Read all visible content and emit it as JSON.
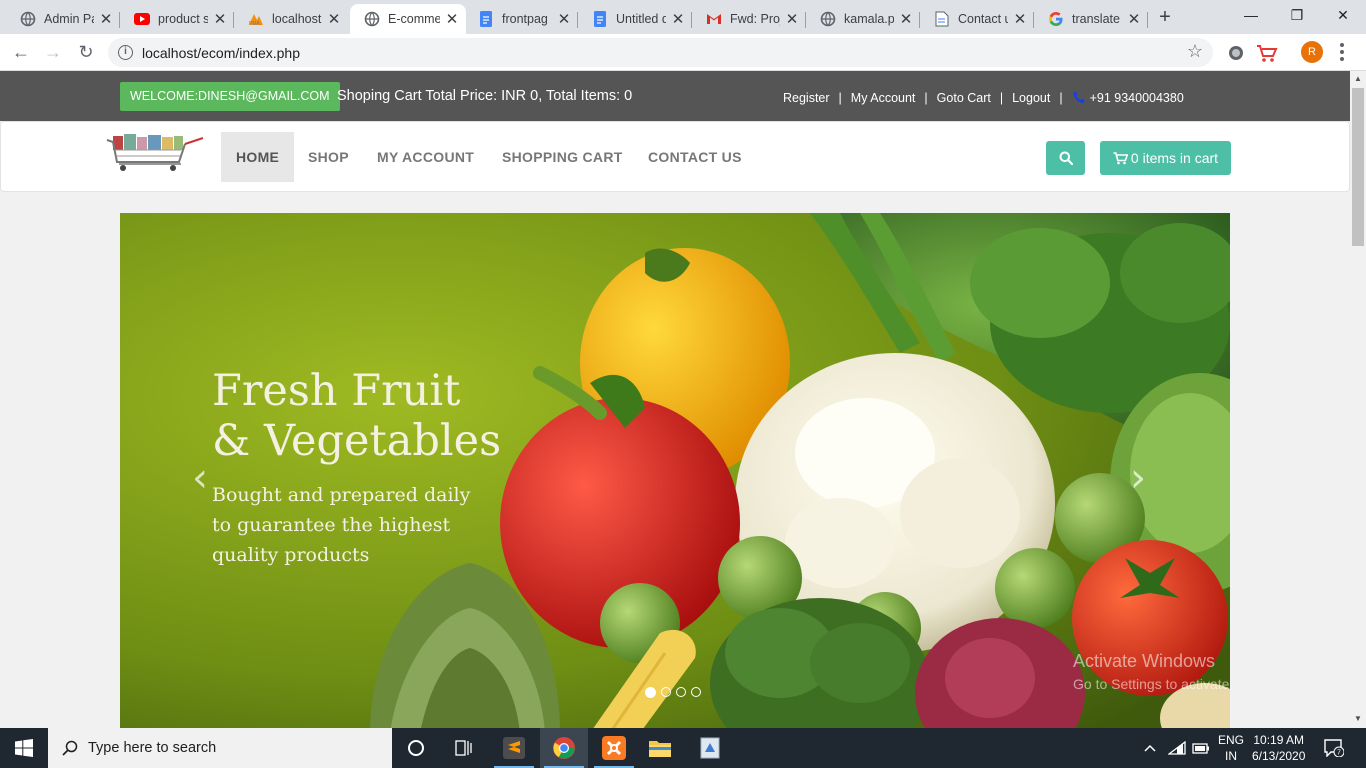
{
  "browser": {
    "tabs": [
      {
        "title": "Admin Pa",
        "icon": "globe-icon"
      },
      {
        "title": "product s",
        "icon": "youtube-icon"
      },
      {
        "title": "localhost",
        "icon": "phpmyadmin-icon"
      },
      {
        "title": "E-comme",
        "icon": "globe-icon",
        "active": true
      },
      {
        "title": "frontpag",
        "icon": "docs-icon"
      },
      {
        "title": "Untitled d",
        "icon": "docs-icon"
      },
      {
        "title": "Fwd: Proj",
        "icon": "gmail-icon"
      },
      {
        "title": "kamala.p",
        "icon": "globe-icon"
      },
      {
        "title": "Contact u",
        "icon": "page-icon"
      },
      {
        "title": "translate",
        "icon": "google-icon"
      }
    ],
    "url": "localhost/ecom/index.php",
    "profile_initial": "R"
  },
  "topbar": {
    "welcome": "WELCOME:DINESH@GMAIL.COM",
    "cart_summary": "Shoping Cart Total Price: INR 0, Total Items: 0",
    "links": [
      "Register",
      "My Account",
      "Goto Cart",
      "Logout"
    ],
    "separator": "|",
    "phone": "+91 9340004380"
  },
  "nav": {
    "items": [
      "HOME",
      "SHOP",
      "MY ACCOUNT",
      "SHOPPING CART",
      "CONTACT US"
    ],
    "active": "HOME",
    "cart_button": "0 items in cart"
  },
  "slider": {
    "title_line1": "Fresh Fruit",
    "title_line2": "& Vegetables",
    "subtitle": "Bought and prepared daily to guarantee the highest quality products",
    "prev_arrow": "‹",
    "next_arrow": "›",
    "slide_count": 4,
    "active_slide": 1
  },
  "watermark": {
    "line1": "Activate Windows",
    "line2": "Go to Settings to activate Windows."
  },
  "taskbar": {
    "search_placeholder": "Type here to search",
    "lang_line1": "ENG",
    "lang_line2": "IN",
    "time": "10:19 AM",
    "date": "6/13/2020",
    "notifications": "7"
  },
  "colors": {
    "teal": "#4cbfa6",
    "green": "#5cb85c",
    "topbar": "#555555"
  }
}
